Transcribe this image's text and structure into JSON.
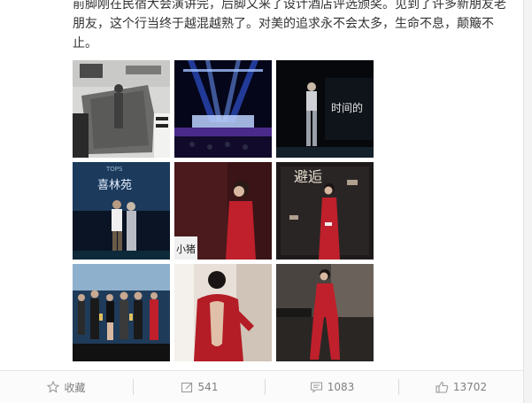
{
  "post": {
    "text_lines": [
      "前脚刚在民宿大会演讲完，后脚又来了设计酒店评选颁奖。见到了许多新朋友老",
      "朋友，这个行当终于越混越熟了。对美的追求永不会太多，生命不息，颠簸不",
      "止。"
    ]
  },
  "gallery": {
    "images": [
      {
        "name": "photo-stage-artwork",
        "desc": "woman leaning on gray art installation on stage"
      },
      {
        "name": "photo-stage-lights",
        "desc": "stage with blue spotlights"
      },
      {
        "name": "photo-speaker-stage",
        "desc": "speaker on dark stage with screen text"
      },
      {
        "name": "photo-two-on-stage",
        "desc": "two people on stage under blue screen"
      },
      {
        "name": "photo-red-suit-portrait",
        "desc": "woman in red suit with red background"
      },
      {
        "name": "photo-red-suit-backdrop",
        "desc": "woman in red suit in front of logo wall"
      },
      {
        "name": "photo-group-awards",
        "desc": "group holding awards on stage"
      },
      {
        "name": "photo-back-view",
        "desc": "woman in red with open back"
      },
      {
        "name": "photo-red-suit-full",
        "desc": "woman in red suit full body"
      }
    ],
    "screen_texts": {
      "tops_label": "TOPS",
      "stage_name": "喜林苑",
      "screen_text": "时间的",
      "backdrop_text": "避逅",
      "sign_text": "小猪"
    }
  },
  "actions": {
    "favorite": {
      "label": "收藏",
      "icon": "star-icon"
    },
    "repost": {
      "label": "541",
      "icon": "repost-icon"
    },
    "comment": {
      "label": "1083",
      "icon": "comment-icon"
    },
    "like": {
      "label": "13702",
      "icon": "thumbs-up-icon"
    }
  },
  "colors": {
    "text": "#333333",
    "action_text": "#808080",
    "bar_background": "#fbfbfb",
    "red_suit": "#c0202b"
  }
}
